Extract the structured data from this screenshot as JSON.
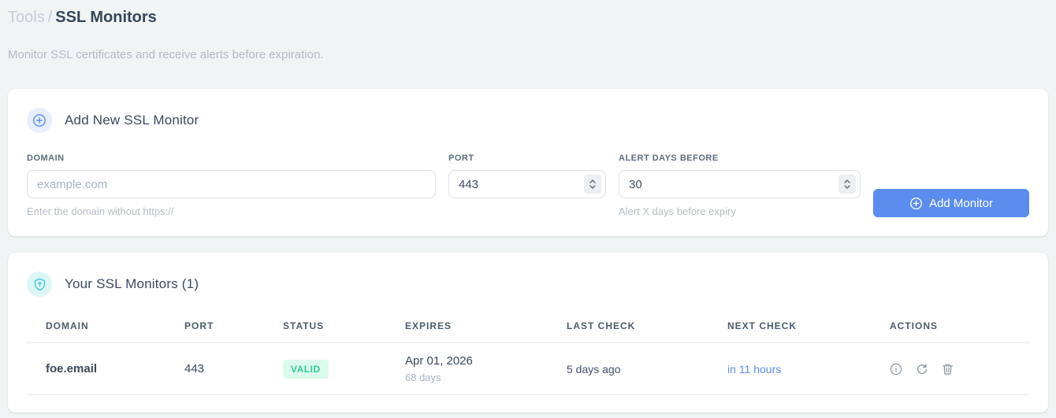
{
  "breadcrumb": {
    "section": "Tools",
    "separator": "/",
    "page": "SSL Monitors"
  },
  "subtitle": "Monitor SSL certificates and receive alerts before expiration.",
  "add_monitor_card": {
    "title": "Add New SSL Monitor",
    "fields": {
      "domain": {
        "label": "DOMAIN",
        "placeholder": "example.com",
        "helper": "Enter the domain without https://",
        "value": ""
      },
      "port": {
        "label": "PORT",
        "value": "443"
      },
      "alert_days": {
        "label": "ALERT DAYS BEFORE",
        "value": "30",
        "helper": "Alert X days before expiry"
      }
    },
    "submit_label": "Add Monitor"
  },
  "monitors_card": {
    "title": "Your SSL Monitors (1)",
    "table": {
      "headers": [
        "DOMAIN",
        "PORT",
        "STATUS",
        "EXPIRES",
        "LAST CHECK",
        "NEXT CHECK",
        "ACTIONS"
      ],
      "rows": [
        {
          "domain": "foe.email",
          "port": "443",
          "status": "VALID",
          "expires_date": "Apr 01, 2026",
          "expires_days": "68 days",
          "last_check": "5 days ago",
          "next_check": "in 11 hours"
        }
      ]
    }
  },
  "icons": {
    "plus_circle": "plus-circle-icon",
    "shield": "shield-icon",
    "info": "info-icon",
    "refresh": "refresh-icon",
    "trash": "trash-icon"
  },
  "colors": {
    "accent_blue": "#5b8def",
    "valid_text": "#2ecb8f",
    "valid_bg": "#dcfaeb",
    "shield_cyan": "#3fc9d9",
    "page_bg": "#f1f4f5"
  }
}
